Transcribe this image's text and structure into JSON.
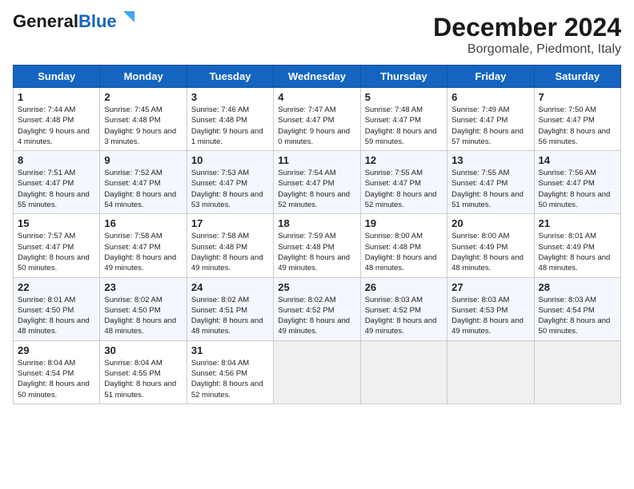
{
  "header": {
    "logo_line1": "General",
    "logo_line2": "Blue",
    "title": "December 2024",
    "subtitle": "Borgomale, Piedmont, Italy"
  },
  "days_of_week": [
    "Sunday",
    "Monday",
    "Tuesday",
    "Wednesday",
    "Thursday",
    "Friday",
    "Saturday"
  ],
  "weeks": [
    [
      {
        "day": "1",
        "rise": "7:44 AM",
        "set": "4:48 PM",
        "daylight": "9 hours and 4 minutes."
      },
      {
        "day": "2",
        "rise": "7:45 AM",
        "set": "4:48 PM",
        "daylight": "9 hours and 3 minutes."
      },
      {
        "day": "3",
        "rise": "7:46 AM",
        "set": "4:48 PM",
        "daylight": "9 hours and 1 minute."
      },
      {
        "day": "4",
        "rise": "7:47 AM",
        "set": "4:47 PM",
        "daylight": "9 hours and 0 minutes."
      },
      {
        "day": "5",
        "rise": "7:48 AM",
        "set": "4:47 PM",
        "daylight": "8 hours and 59 minutes."
      },
      {
        "day": "6",
        "rise": "7:49 AM",
        "set": "4:47 PM",
        "daylight": "8 hours and 57 minutes."
      },
      {
        "day": "7",
        "rise": "7:50 AM",
        "set": "4:47 PM",
        "daylight": "8 hours and 56 minutes."
      }
    ],
    [
      {
        "day": "8",
        "rise": "7:51 AM",
        "set": "4:47 PM",
        "daylight": "8 hours and 55 minutes."
      },
      {
        "day": "9",
        "rise": "7:52 AM",
        "set": "4:47 PM",
        "daylight": "8 hours and 54 minutes."
      },
      {
        "day": "10",
        "rise": "7:53 AM",
        "set": "4:47 PM",
        "daylight": "8 hours and 53 minutes."
      },
      {
        "day": "11",
        "rise": "7:54 AM",
        "set": "4:47 PM",
        "daylight": "8 hours and 52 minutes."
      },
      {
        "day": "12",
        "rise": "7:55 AM",
        "set": "4:47 PM",
        "daylight": "8 hours and 52 minutes."
      },
      {
        "day": "13",
        "rise": "7:55 AM",
        "set": "4:47 PM",
        "daylight": "8 hours and 51 minutes."
      },
      {
        "day": "14",
        "rise": "7:56 AM",
        "set": "4:47 PM",
        "daylight": "8 hours and 50 minutes."
      }
    ],
    [
      {
        "day": "15",
        "rise": "7:57 AM",
        "set": "4:47 PM",
        "daylight": "8 hours and 50 minutes."
      },
      {
        "day": "16",
        "rise": "7:58 AM",
        "set": "4:47 PM",
        "daylight": "8 hours and 49 minutes."
      },
      {
        "day": "17",
        "rise": "7:58 AM",
        "set": "4:48 PM",
        "daylight": "8 hours and 49 minutes."
      },
      {
        "day": "18",
        "rise": "7:59 AM",
        "set": "4:48 PM",
        "daylight": "8 hours and 49 minutes."
      },
      {
        "day": "19",
        "rise": "8:00 AM",
        "set": "4:48 PM",
        "daylight": "8 hours and 48 minutes."
      },
      {
        "day": "20",
        "rise": "8:00 AM",
        "set": "4:49 PM",
        "daylight": "8 hours and 48 minutes."
      },
      {
        "day": "21",
        "rise": "8:01 AM",
        "set": "4:49 PM",
        "daylight": "8 hours and 48 minutes."
      }
    ],
    [
      {
        "day": "22",
        "rise": "8:01 AM",
        "set": "4:50 PM",
        "daylight": "8 hours and 48 minutes."
      },
      {
        "day": "23",
        "rise": "8:02 AM",
        "set": "4:50 PM",
        "daylight": "8 hours and 48 minutes."
      },
      {
        "day": "24",
        "rise": "8:02 AM",
        "set": "4:51 PM",
        "daylight": "8 hours and 48 minutes."
      },
      {
        "day": "25",
        "rise": "8:02 AM",
        "set": "4:52 PM",
        "daylight": "8 hours and 49 minutes."
      },
      {
        "day": "26",
        "rise": "8:03 AM",
        "set": "4:52 PM",
        "daylight": "8 hours and 49 minutes."
      },
      {
        "day": "27",
        "rise": "8:03 AM",
        "set": "4:53 PM",
        "daylight": "8 hours and 49 minutes."
      },
      {
        "day": "28",
        "rise": "8:03 AM",
        "set": "4:54 PM",
        "daylight": "8 hours and 50 minutes."
      }
    ],
    [
      {
        "day": "29",
        "rise": "8:04 AM",
        "set": "4:54 PM",
        "daylight": "8 hours and 50 minutes."
      },
      {
        "day": "30",
        "rise": "8:04 AM",
        "set": "4:55 PM",
        "daylight": "8 hours and 51 minutes."
      },
      {
        "day": "31",
        "rise": "8:04 AM",
        "set": "4:56 PM",
        "daylight": "8 hours and 52 minutes."
      },
      null,
      null,
      null,
      null
    ]
  ],
  "labels": {
    "sunrise": "Sunrise:",
    "sunset": "Sunset:",
    "daylight": "Daylight:"
  }
}
